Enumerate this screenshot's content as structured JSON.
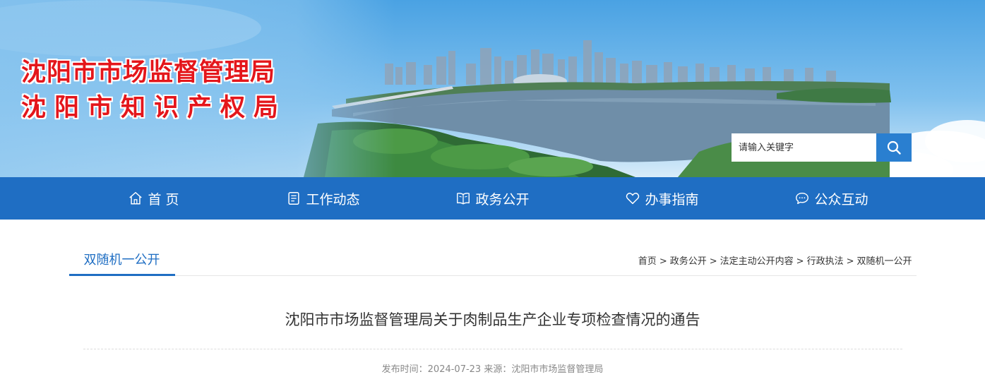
{
  "header": {
    "title_line1": "沈阳市市场监督管理局",
    "title_line2": "沈阳市知识产权局",
    "search_placeholder": "请输入关键字"
  },
  "nav": {
    "items": [
      {
        "label": "首 页",
        "icon": "home-icon"
      },
      {
        "label": "工作动态",
        "icon": "document-icon"
      },
      {
        "label": "政务公开",
        "icon": "open-book-icon"
      },
      {
        "label": "办事指南",
        "icon": "heart-icon"
      },
      {
        "label": "公众互动",
        "icon": "chat-bubble-icon"
      }
    ]
  },
  "section": {
    "tab_label": "双随机一公开",
    "breadcrumb": [
      "首页",
      "政务公开",
      "法定主动公开内容",
      "行政执法",
      "双随机一公开"
    ],
    "separator": ">"
  },
  "article": {
    "title": "沈阳市市场监督管理局关于肉制品生产企业专项检查情况的通告",
    "meta": "发布时间：2024-07-23 来源：沈阳市市场监督管理局"
  },
  "colors": {
    "nav_bg": "#1f6ec3",
    "title_red": "#e4161b",
    "search_button": "#2a7fd0"
  }
}
